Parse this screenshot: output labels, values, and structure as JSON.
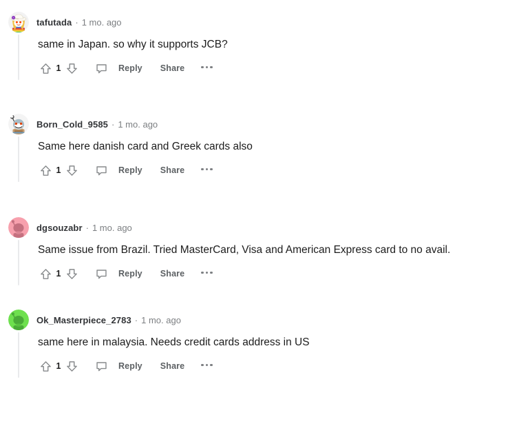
{
  "theme": {
    "background": "#ffffff",
    "body_text_color": "#1c1c1c",
    "author_color": "#333538",
    "meta_color": "#7c7f82",
    "action_color": "#5c6063",
    "thread_line_color": "#e9eaec"
  },
  "actions": {
    "upvote_label": "upvote",
    "downvote_label": "downvote",
    "comment_label": "comment",
    "reply_label": "Reply",
    "share_label": "Share",
    "more_label": "more options"
  },
  "separator": "·",
  "comments": [
    {
      "author": "tafutada",
      "timestamp": "1 mo. ago",
      "body": "same in Japan. so why it supports JCB?",
      "votes": "1",
      "avatar": {
        "name": "avatar-tafutada",
        "style": "custom-hat-rainbow",
        "bg": "#f2f2f2",
        "skin": "#ffffff",
        "hat": "#fbf7ee",
        "flower": "#8c3bbd",
        "hair": "#f0c248",
        "eyes": "#ff4500"
      }
    },
    {
      "author": "Born_Cold_9585",
      "timestamp": "1 mo. ago",
      "body": "Same here danish card and Greek cards also",
      "votes": "1",
      "avatar": {
        "name": "avatar-born-cold-9585",
        "style": "gray-snoo-antenna",
        "bg": "#f4f4f4",
        "skin": "#a8bcc6",
        "body": "#c49a6c",
        "eyes": "#ff4500",
        "mouth": "#ffffff"
      }
    },
    {
      "author": "dgsouzabr",
      "timestamp": "1 mo. ago",
      "body": "Same issue from Brazil. Tried MasterCard, Visa and American Express card to no avail.",
      "votes": "1",
      "avatar": {
        "name": "avatar-dgsouzabr",
        "style": "flat-snoo",
        "bg": "#f7a0ad",
        "skin": "#c4707f"
      }
    },
    {
      "author": "Ok_Masterpiece_2783",
      "timestamp": "1 mo. ago",
      "body": "same here in malaysia. Needs credit cards address in US",
      "votes": "1",
      "avatar": {
        "name": "avatar-ok-masterpiece-2783",
        "style": "flat-snoo",
        "bg": "#6ee04e",
        "skin": "#4aab38"
      }
    }
  ]
}
